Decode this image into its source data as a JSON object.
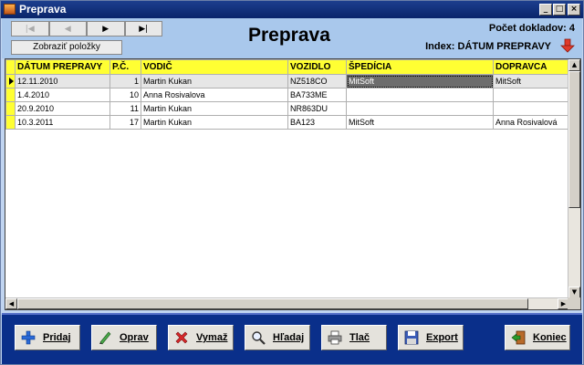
{
  "window": {
    "title": "Preprava",
    "controls": {
      "minimize": "_",
      "maximize": "□",
      "close": "×"
    }
  },
  "header": {
    "nav_buttons": [
      {
        "name": "first",
        "glyph": "|◀",
        "enabled": false
      },
      {
        "name": "prev",
        "glyph": "◀",
        "enabled": false
      },
      {
        "name": "next",
        "glyph": "▶",
        "enabled": true
      },
      {
        "name": "last",
        "glyph": "▶|",
        "enabled": true
      }
    ],
    "show_items_label": "Zobraziť položky",
    "page_title": "Preprava",
    "doc_count": "Počet dokladov: 4",
    "index_info": "Index: DÁTUM PREPRAVY",
    "sort_icon": "sort-down-arrow-icon",
    "sort_icon_color": "#e03a2a"
  },
  "grid": {
    "columns": [
      "DÁTUM PREPRAVY",
      "P.Č.",
      "VODIČ",
      "VOZIDLO",
      "ŠPEDÍCIA",
      "DOPRAVCA"
    ],
    "rows": [
      {
        "datum": "12.11.2010",
        "pc": "1",
        "vodic": "Martin  Kukan",
        "vozidlo": "NZ518CO",
        "spedicia": "MitSoft",
        "dopravca": "MitSoft",
        "current": true
      },
      {
        "datum": "1.4.2010",
        "pc": "10",
        "vodic": "Anna  Rosivalova",
        "vozidlo": "BA733ME",
        "spedicia": "",
        "dopravca": "",
        "current": false
      },
      {
        "datum": "20.9.2010",
        "pc": "11",
        "vodic": "Martin  Kukan",
        "vozidlo": "NR863DU",
        "spedicia": "",
        "dopravca": "",
        "current": false
      },
      {
        "datum": "10.3.2011",
        "pc": "17",
        "vodic": "Martin  Kukan",
        "vozidlo": "BA123",
        "spedicia": "MitSoft",
        "dopravca": "Anna Rosivalová",
        "current": false
      }
    ],
    "header_color": "#ffff33"
  },
  "toolbar": {
    "buttons": [
      {
        "id": "pridaj",
        "label": "Pridaj",
        "icon": "plus-icon"
      },
      {
        "id": "oprav",
        "label": "Oprav",
        "icon": "pencil-icon"
      },
      {
        "id": "vymaz",
        "label": "Vymaž",
        "icon": "delete-x-icon"
      },
      {
        "id": "hladaj",
        "label": "Hľadaj",
        "icon": "magnifier-icon"
      },
      {
        "id": "tlac",
        "label": "Tlač",
        "icon": "printer-icon"
      },
      {
        "id": "export",
        "label": "Export",
        "icon": "floppy-disk-icon"
      },
      {
        "id": "koniec",
        "label": "Koniec",
        "icon": "exit-door-icon"
      }
    ],
    "background": "#0a2f8a"
  }
}
